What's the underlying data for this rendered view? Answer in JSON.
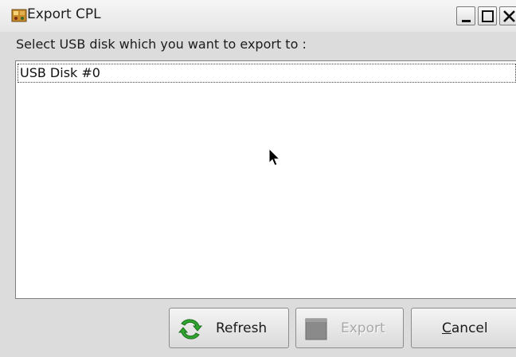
{
  "window": {
    "title": "Export CPL",
    "app_icon": "export-app-icon",
    "controls": {
      "minimize_icon": "minimize-icon",
      "maximize_icon": "maximize-icon",
      "close_icon": "close-icon"
    }
  },
  "prompt": "Select USB disk which you want to export to :",
  "disk_list": {
    "items": [
      {
        "label": "USB Disk #0"
      }
    ]
  },
  "buttons": {
    "refresh": {
      "label": "Refresh",
      "icon": "refresh-icon"
    },
    "export": {
      "label": "Export",
      "icon": "export-icon",
      "enabled": false
    },
    "cancel": {
      "label_mnemonic": "C",
      "label_rest": "ancel"
    }
  },
  "colors": {
    "window_bg": "#dcdcdc",
    "list_bg": "#ffffff",
    "disabled_text": "#a8a8a8",
    "refresh_green": "#2fa52f"
  }
}
